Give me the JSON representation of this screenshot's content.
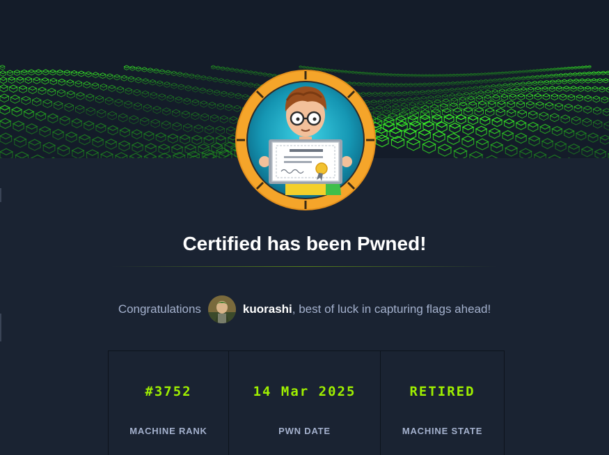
{
  "header": {
    "title": "Certified has been Pwned!"
  },
  "congrats": {
    "prefix": "Congratulations",
    "username": "kuorashi",
    "suffix": ", best of luck in capturing flags ahead!"
  },
  "stats": [
    {
      "value": "#3752",
      "label": "MACHINE RANK"
    },
    {
      "value": "14 Mar 2025",
      "label": "PWN DATE"
    },
    {
      "value": "RETIRED",
      "label": "MACHINE STATE"
    }
  ],
  "badge": {
    "certificate_scribble": "Congratulations"
  },
  "colors": {
    "background": "#1a2332",
    "accent_green": "#9fef00",
    "badge_ring": "#f5a52a",
    "text_muted": "#a4b1cd"
  },
  "icons": [
    "machine-avatar-icon",
    "user-avatar-icon"
  ]
}
